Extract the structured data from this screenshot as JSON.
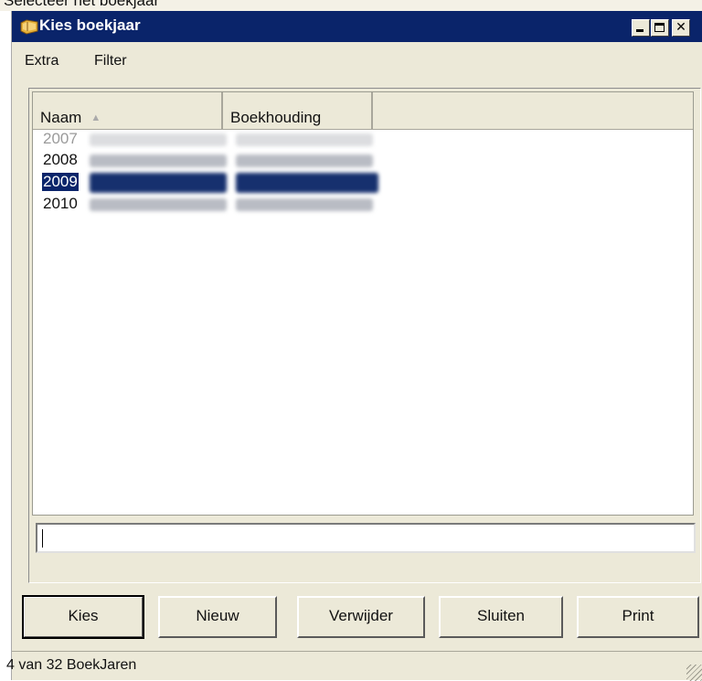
{
  "window": {
    "title": "Kies boekjaar",
    "icon": "folder-book-icon",
    "controls": [
      "minimize",
      "maximize",
      "close"
    ]
  },
  "menu": {
    "items": [
      "Extra",
      "Filter"
    ]
  },
  "list": {
    "columns": [
      "Naam",
      "Boekhouding"
    ],
    "sort_indicator": "▲",
    "rows": [
      {
        "year": "2007",
        "state": "disabled"
      },
      {
        "year": "2008",
        "state": "normal"
      },
      {
        "year": "2009",
        "state": "selected"
      },
      {
        "year": "2010",
        "state": "normal"
      }
    ]
  },
  "input": {
    "value": ""
  },
  "buttons": {
    "kies": "Kies",
    "nieuw": "Nieuw",
    "verwijder": "Verwijder",
    "sluiten": "Sluiten",
    "print": "Print"
  },
  "status": {
    "text": "4 van 32 BoekJaren"
  },
  "colors": {
    "titlebar": "#0a246a",
    "face": "#ece9d8",
    "selection": "#0a246a"
  }
}
